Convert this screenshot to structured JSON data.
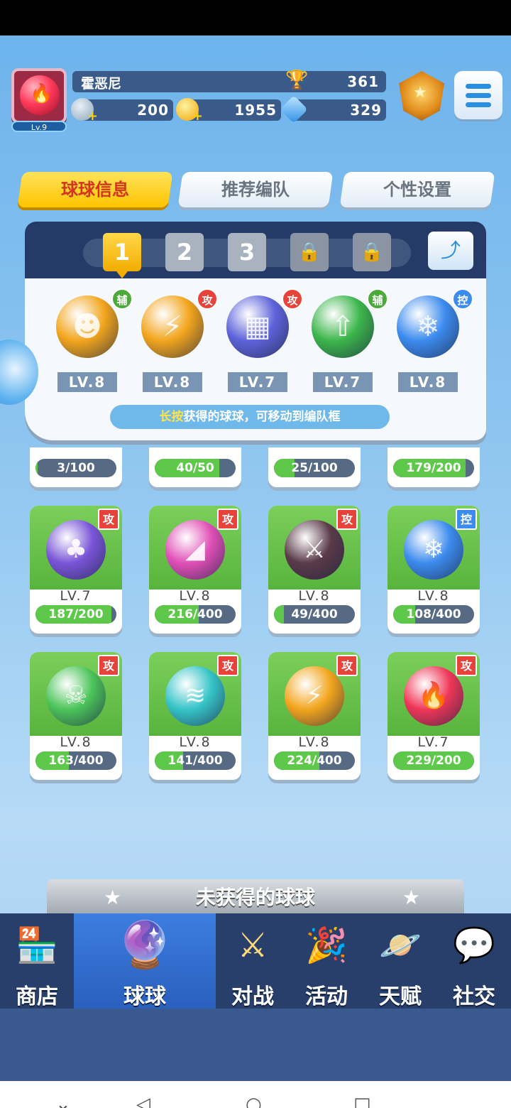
{
  "player": {
    "name": "霍恶尼",
    "level_badge": "Lv.9",
    "trophies": "361",
    "silver": "200",
    "gold": "1955",
    "diamonds": "329"
  },
  "tabs": [
    {
      "label": "球球信息",
      "active": true
    },
    {
      "label": "推荐编队",
      "active": false
    },
    {
      "label": "个性设置",
      "active": false
    }
  ],
  "team": {
    "slots": [
      "1",
      "2",
      "3",
      "🔒",
      "🔒"
    ],
    "active_slot": 0,
    "balls": [
      {
        "tag": "辅",
        "level": "LV.8",
        "color": "#f2a51d",
        "glyph": "☻"
      },
      {
        "tag": "攻",
        "level": "LV.8",
        "color": "#f2a51d",
        "glyph": "⚡"
      },
      {
        "tag": "攻",
        "level": "LV.7",
        "color": "#5d63d9",
        "glyph": "▦"
      },
      {
        "tag": "辅",
        "level": "LV.7",
        "color": "#3cb64b",
        "glyph": "⇧"
      },
      {
        "tag": "控",
        "level": "LV.8",
        "color": "#3c8bee",
        "glyph": "❄"
      }
    ],
    "hint_highlight": "长按",
    "hint_text": "获得的球球，可移动到编队框"
  },
  "partial_row": [
    {
      "progress_text": "3/100",
      "progress": 0.03
    },
    {
      "progress_text": "40/50",
      "progress": 0.8
    },
    {
      "progress_text": "25/100",
      "progress": 0.25
    },
    {
      "progress_text": "179/200",
      "progress": 0.895
    }
  ],
  "cards": [
    {
      "tag": "攻",
      "level": "LV.7",
      "progress_text": "187/200",
      "progress": 0.935,
      "color": "#7a55d8",
      "glyph": "♣"
    },
    {
      "tag": "攻",
      "level": "LV.8",
      "progress_text": "216/400",
      "progress": 0.54,
      "color": "#e04fb6",
      "glyph": "◢"
    },
    {
      "tag": "攻",
      "level": "LV.8",
      "progress_text": "49/400",
      "progress": 0.12,
      "color": "#5a3a48",
      "glyph": "⚔"
    },
    {
      "tag": "控",
      "level": "LV.8",
      "progress_text": "108/400",
      "progress": 0.27,
      "color": "#3c8bee",
      "glyph": "❄"
    },
    {
      "tag": "攻",
      "level": "LV.8",
      "progress_text": "163/400",
      "progress": 0.41,
      "color": "#4cc45a",
      "glyph": "☠"
    },
    {
      "tag": "攻",
      "level": "LV.8",
      "progress_text": "141/400",
      "progress": 0.35,
      "color": "#36c4c8",
      "glyph": "≋"
    },
    {
      "tag": "攻",
      "level": "LV.8",
      "progress_text": "224/400",
      "progress": 0.56,
      "color": "#f2a51d",
      "glyph": "⚡"
    },
    {
      "tag": "攻",
      "level": "LV.7",
      "progress_text": "229/200",
      "progress": 1.0,
      "color": "#ef3658",
      "glyph": "🔥"
    }
  ],
  "unowned_banner": "未获得的球球",
  "nav": [
    {
      "label": "商店",
      "icon": "🏪",
      "active": false
    },
    {
      "label": "球球",
      "icon": "🔮",
      "active": true
    },
    {
      "label": "对战",
      "icon": "⚔",
      "active": false
    },
    {
      "label": "活动",
      "icon": "🎉",
      "active": false
    },
    {
      "label": "天赋",
      "icon": "🪐",
      "active": false
    },
    {
      "label": "社交",
      "icon": "💬",
      "active": false
    }
  ],
  "colors": {
    "tag_attack": "#e8433b",
    "tag_support": "#4caa3c",
    "tag_control": "#3c8bee"
  }
}
